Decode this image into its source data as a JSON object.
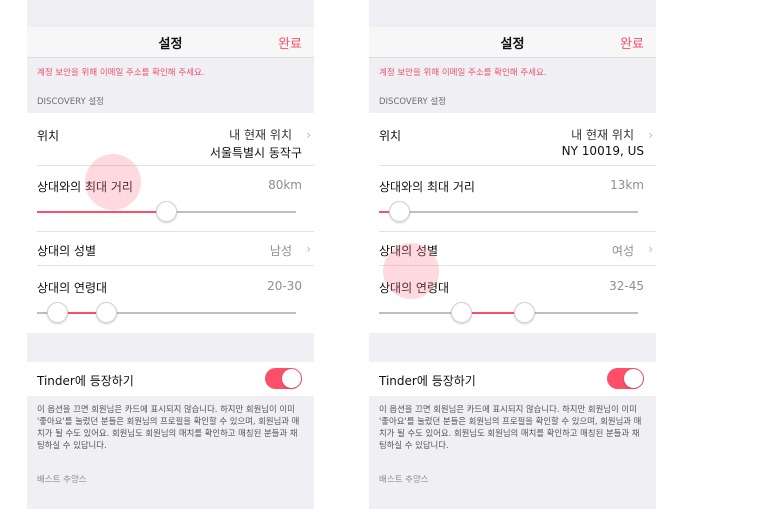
{
  "colors": {
    "accent": "#fd4f6a",
    "background": "#efeff4"
  },
  "screens": [
    {
      "nav_title": "설정",
      "nav_done": "완료",
      "warning": "계정 보안을 위해 이메일 주소를 확인해 주세요.",
      "section_label": "DISCOVERY 설정",
      "location_label": "위치",
      "location_line1": "내 현재 위치",
      "location_line2": "서울특별시 동작구",
      "distance_label": "상대와의 최대 거리",
      "distance_value": "80km",
      "distance_fraction": 0.5,
      "gender_label": "상대의 성별",
      "gender_value": "남성",
      "age_label": "상대의 연령대",
      "age_value": "20-30",
      "age_low_fraction": 0.08,
      "age_high_fraction": 0.27,
      "show_label": "Tinder에 등장하기",
      "show_enabled": true,
      "description": "이 옵션을 끄면 회원님은 카드에 표시되지 않습니다. 하지만 회원님이 이미 '좋아요'를 눌렀던 분들은 회원님의 프로필을 확인할 수 있으며, 회원님과 매치가 될 수도 있어요. 회원님도 회원님의 매치를 확인하고 매칭된 분들과 채팅하실 수 있답니다.",
      "cutoff_text": "배스트 추양스"
    },
    {
      "nav_title": "설정",
      "nav_done": "완료",
      "warning": "계정 보안을 위해 이메일 주소를 확인해 주세요.",
      "section_label": "DISCOVERY 설정",
      "location_label": "위치",
      "location_line1": "내 현재 위치",
      "location_line2": "NY 10019, US",
      "distance_label": "상대와의 최대 거리",
      "distance_value": "13km",
      "distance_fraction": 0.08,
      "gender_label": "상대의 성별",
      "gender_value": "여성",
      "age_label": "상대의 연령대",
      "age_value": "32-45",
      "age_low_fraction": 0.32,
      "age_high_fraction": 0.56,
      "show_label": "Tinder에 등장하기",
      "show_enabled": true,
      "description": "이 옵션을 끄면 회원님은 카드에 표시되지 않습니다. 하지만 회원님이 이미 '좋아요'를 눌렀던 분들은 회원님의 프로필을 확인할 수 있으며, 회원님과 매치가 될 수도 있어요. 회원님도 회원님의 매치를 확인하고 매칭된 분들과 채팅하실 수 있답니다.",
      "cutoff_text": "배스트 추양스"
    }
  ]
}
